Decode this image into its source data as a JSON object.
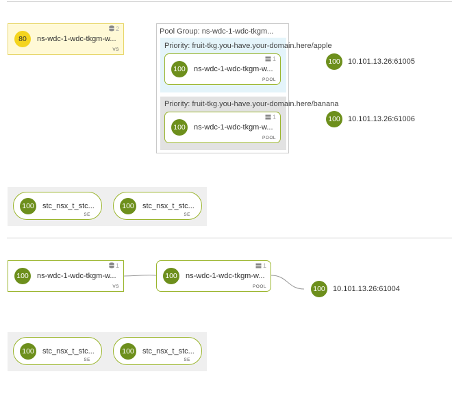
{
  "sections": [
    {
      "virtual_service": {
        "score": "80",
        "name": "ns-wdc-1-wdc-tkgm-w...",
        "type": "VS",
        "count": "2"
      },
      "pool_group": {
        "title": "Pool Group: ns-wdc-1-wdc-tkgm...",
        "priorities": [
          {
            "label": "Priority: fruit-tkg.you-have.your-domain.here/apple",
            "pool": {
              "score": "100",
              "name": "ns-wdc-1-wdc-tkgm-w...",
              "type": "POOL",
              "count": "1"
            },
            "server": {
              "score": "100",
              "address": "10.101.13.26:61005"
            }
          },
          {
            "label": "Priority: fruit-tkg.you-have.your-domain.here/banana",
            "pool": {
              "score": "100",
              "name": "ns-wdc-1-wdc-tkgm-w...",
              "type": "POOL",
              "count": "1"
            },
            "server": {
              "score": "100",
              "address": "10.101.13.26:61006"
            }
          }
        ]
      },
      "service_engines": [
        {
          "score": "100",
          "name": "stc_nsx_t_stc...",
          "type": "SE"
        },
        {
          "score": "100",
          "name": "stc_nsx_t_stc...",
          "type": "SE"
        }
      ]
    },
    {
      "virtual_service": {
        "score": "100",
        "name": "ns-wdc-1-wdc-tkgm-w...",
        "type": "VS",
        "count": "1"
      },
      "pool": {
        "score": "100",
        "name": "ns-wdc-1-wdc-tkgm-w...",
        "type": "POOL",
        "count": "1"
      },
      "server": {
        "score": "100",
        "address": "10.101.13.26:61004"
      },
      "service_engines": [
        {
          "score": "100",
          "name": "stc_nsx_t_stc...",
          "type": "SE"
        },
        {
          "score": "100",
          "name": "stc_nsx_t_stc...",
          "type": "SE"
        }
      ]
    }
  ],
  "colors": {
    "health_green": "#6d8f1c",
    "health_yellow": "#f4d41e",
    "node_border": "#9ab52c",
    "priority_blue": "#e4f4fa",
    "priority_gray": "#e2e2e2"
  }
}
